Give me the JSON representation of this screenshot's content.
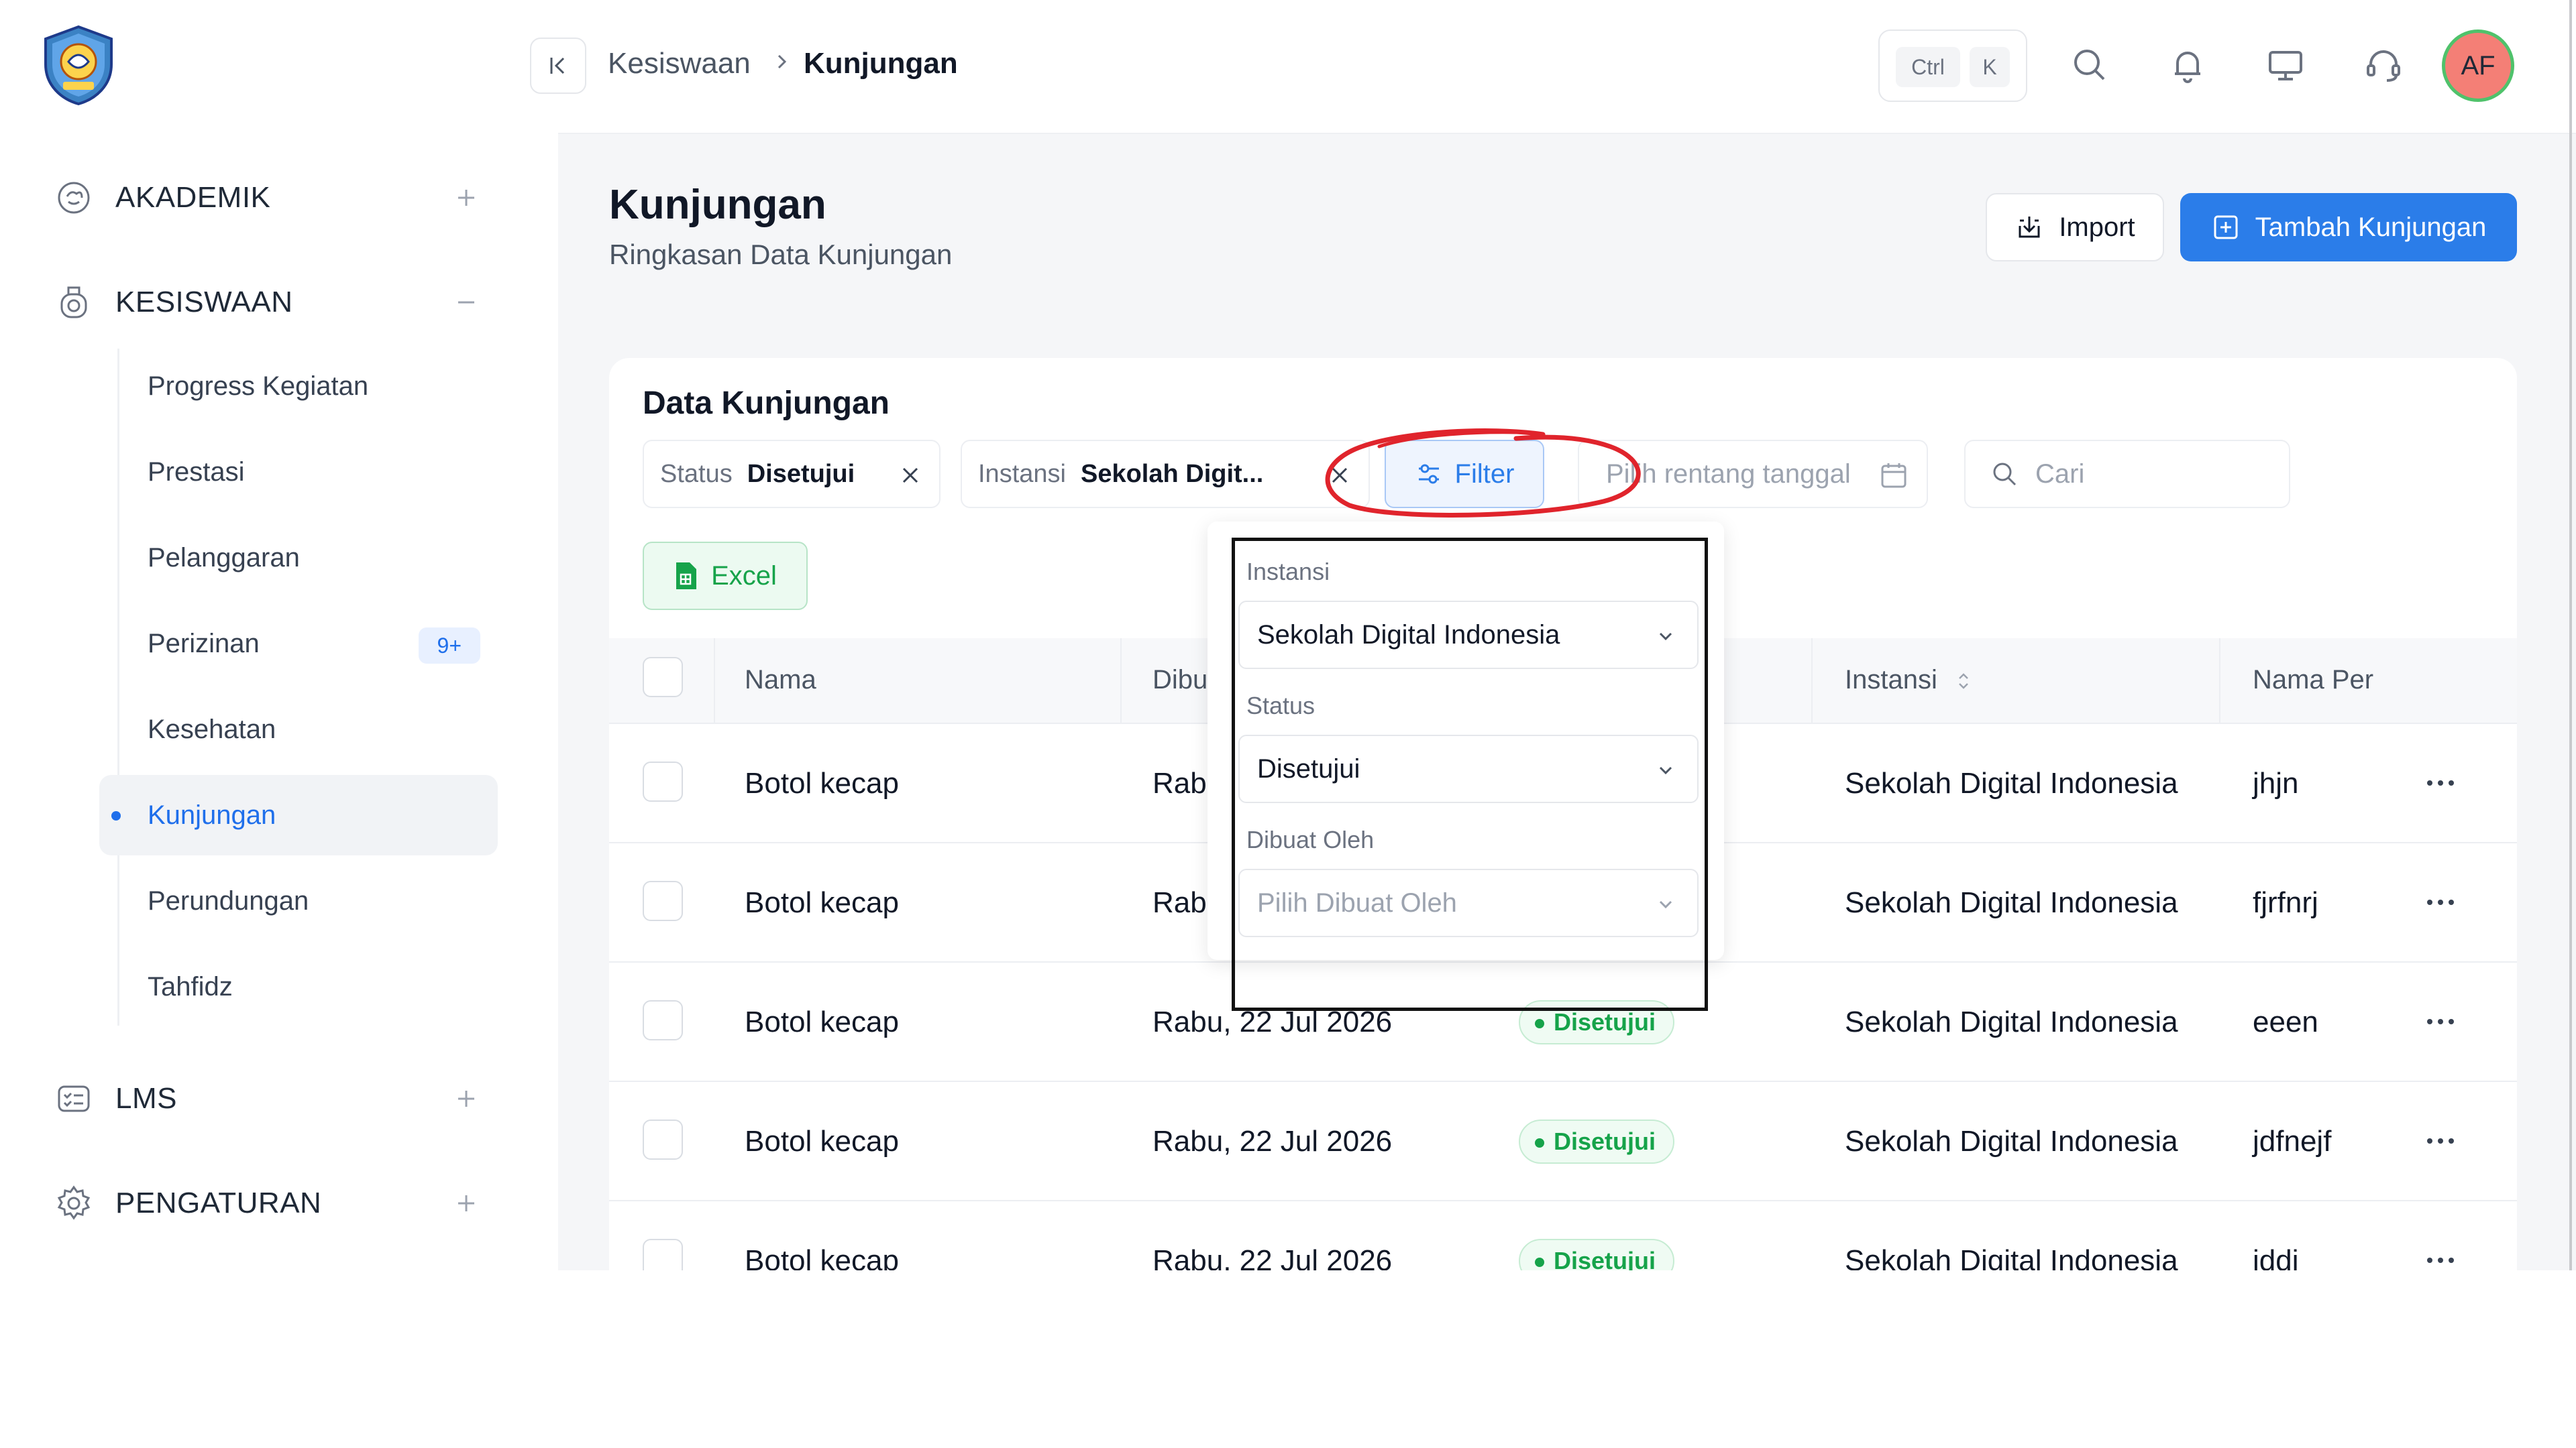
{
  "sidebar": {
    "groups": [
      {
        "label": "AKADEMIK",
        "icon": "brain-icon",
        "toggle": "plus-icon"
      },
      {
        "label": "KESISWAAN",
        "icon": "student-icon",
        "toggle": "minus-icon"
      },
      {
        "label": "LMS",
        "icon": "checklist-icon",
        "toggle": "plus-icon"
      },
      {
        "label": "PENGATURAN",
        "icon": "gear-icon",
        "toggle": "plus-icon"
      }
    ],
    "kesiswaan_items": [
      {
        "label": "Progress Kegiatan"
      },
      {
        "label": "Prestasi"
      },
      {
        "label": "Pelanggaran"
      },
      {
        "label": "Perizinan",
        "badge": "9+"
      },
      {
        "label": "Kesehatan"
      },
      {
        "label": "Kunjungan",
        "active": true
      },
      {
        "label": "Perundungan"
      },
      {
        "label": "Tahfidz"
      }
    ]
  },
  "topbar": {
    "breadcrumb": [
      "Kesiswaan",
      "Kunjungan"
    ],
    "shortcut_keys": [
      "Ctrl",
      "K"
    ],
    "icons": [
      "search-icon",
      "bell-icon",
      "monitor-icon",
      "headset-icon"
    ],
    "avatar_initials": "AF",
    "avatar_bg": "#f47f76",
    "avatar_ring": "#4fc26b"
  },
  "page": {
    "title": "Kunjungan",
    "subtitle": "Ringkasan Data Kunjungan",
    "import_label": "Import",
    "add_label": "Tambah Kunjungan"
  },
  "card": {
    "title": "Data Kunjungan",
    "chips": [
      {
        "key": "Status",
        "value": "Disetujui"
      },
      {
        "key": "Instansi",
        "value": "Sekolah Digit..."
      }
    ],
    "filter_label": "Filter",
    "date_placeholder": "Pilih rentang tanggal",
    "search_placeholder": "Cari",
    "excel_label": "Excel"
  },
  "table": {
    "headers": [
      "Nama",
      "Dibu",
      "",
      "Instansi",
      "Nama Per"
    ],
    "rows": [
      {
        "nama": "Botol kecap",
        "dibuat": "Rab",
        "status": "",
        "instansi": "Sekolah Digital Indonesia",
        "nama_per": "jhjn"
      },
      {
        "nama": "Botol kecap",
        "dibuat": "Rab",
        "status": "",
        "instansi": "Sekolah Digital Indonesia",
        "nama_per": "fjrfnrj"
      },
      {
        "nama": "Botol kecap",
        "dibuat": "Rabu, 22 Jul 2026",
        "status": "Disetujui",
        "instansi": "Sekolah Digital Indonesia",
        "nama_per": "eeen"
      },
      {
        "nama": "Botol kecap",
        "dibuat": "Rabu, 22 Jul 2026",
        "status": "Disetujui",
        "instansi": "Sekolah Digital Indonesia",
        "nama_per": "jdfnejf"
      },
      {
        "nama": "Botol kecap",
        "dibuat": "Rabu, 22 Jul 2026",
        "status": "Disetujui",
        "instansi": "Sekolah Digital Indonesia",
        "nama_per": "iddi"
      }
    ]
  },
  "filter_panel": {
    "instansi_label": "Instansi",
    "instansi_value": "Sekolah Digital Indonesia",
    "status_label": "Status",
    "status_value": "Disetujui",
    "dibuat_oleh_label": "Dibuat Oleh",
    "dibuat_oleh_placeholder": "Pilih Dibuat Oleh"
  },
  "colors": {
    "primary": "#2b7de9",
    "success": "#16a34a",
    "annotation": "#e0242c"
  }
}
